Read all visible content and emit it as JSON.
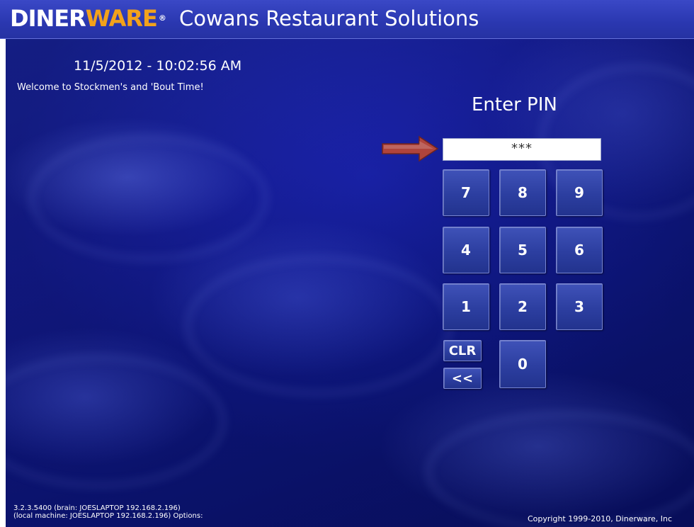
{
  "header": {
    "logo_d": "D",
    "logo_iner": "INER",
    "logo_ware": "WARE",
    "logo_reg": "®",
    "company": "Cowans Restaurant Solutions"
  },
  "status": {
    "datetime": "11/5/2012 - 10:02:56 AM",
    "welcome": "Welcome to Stockmen's and 'Bout Time!"
  },
  "pin": {
    "title": "Enter PIN",
    "value": "***"
  },
  "keypad": {
    "k7": "7",
    "k8": "8",
    "k9": "9",
    "k4": "4",
    "k5": "5",
    "k6": "6",
    "k1": "1",
    "k2": "2",
    "k3": "3",
    "k0": "0",
    "clear": "CLR",
    "backspace": "<<"
  },
  "footer": {
    "version_line1": "3.2.3.5400 (brain: JOESLAPTOP 192.168.2.196)",
    "version_line2": "(local machine: JOESLAPTOP 192.168.2.196) Options:",
    "copyright": "Copyright 1999-2010, Dinerware, Inc"
  },
  "icons": {
    "arrow": "right-arrow-icon"
  },
  "colors": {
    "background": "#1a22a8",
    "header": "#2a37b0",
    "logo_accent": "#f2a21b",
    "arrow": "#b0443c",
    "key_face": "#2c3ea0"
  }
}
